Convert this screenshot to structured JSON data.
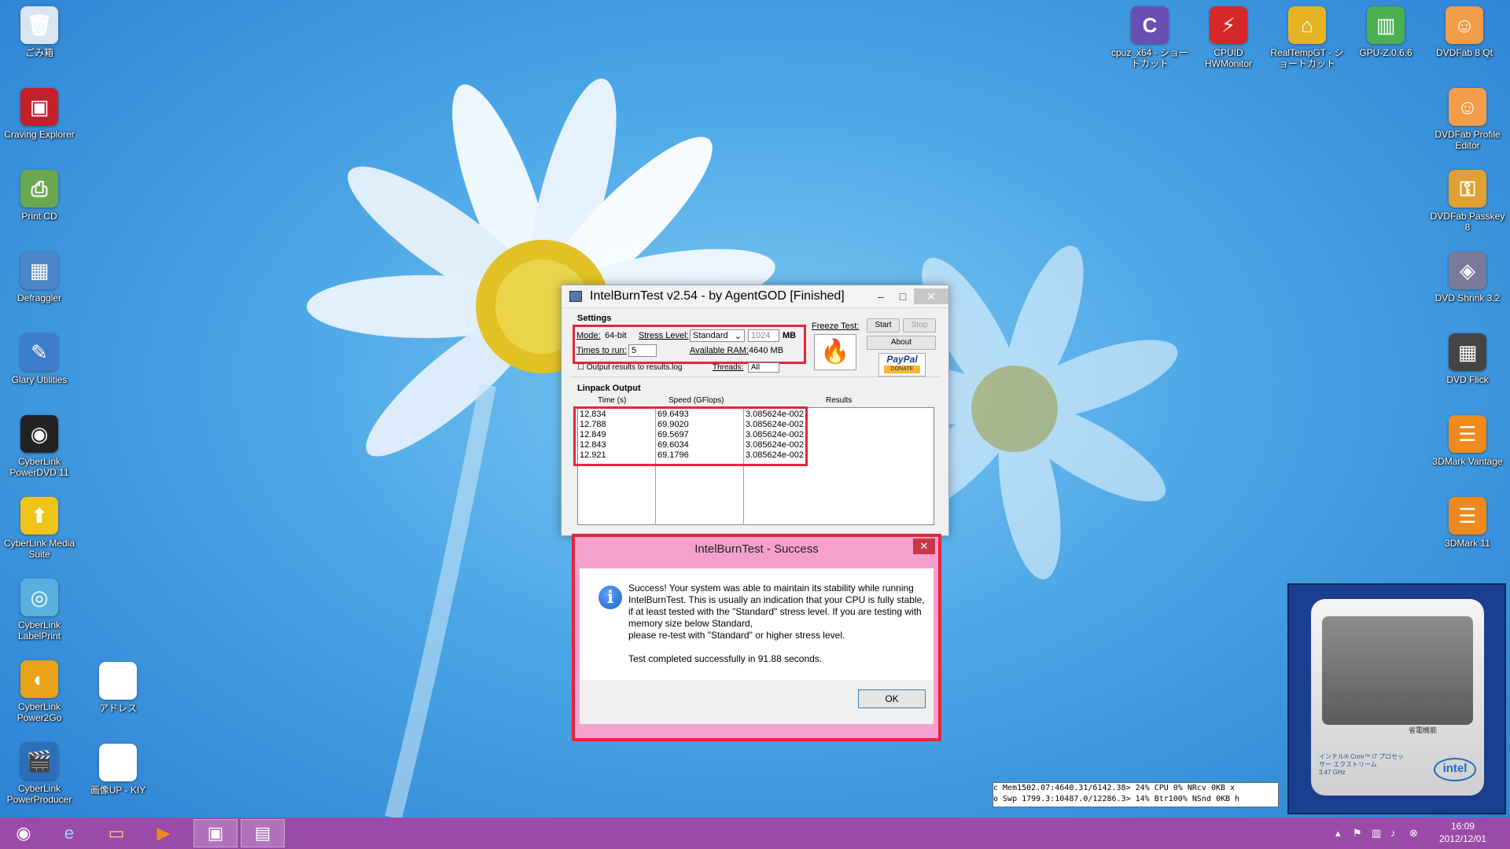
{
  "desktop_left": [
    {
      "label": "ごみ箱",
      "icon": "recycle-bin-icon",
      "glyph": "🗑",
      "color": "#d9e6f2"
    },
    {
      "label": "Craving Explorer",
      "icon": "craving-explorer-icon",
      "glyph": "▣",
      "color": "#c3202b"
    },
    {
      "label": "Print CD",
      "icon": "print-cd-icon",
      "glyph": "⎙",
      "color": "#6aa84f"
    },
    {
      "label": "Defraggler",
      "icon": "defraggler-icon",
      "glyph": "▦",
      "color": "#4a86c8"
    },
    {
      "label": "Glary Utilities",
      "icon": "glary-utilities-icon",
      "glyph": "✎",
      "color": "#3d7cc9"
    },
    {
      "label": "CyberLink PowerDVD 11",
      "icon": "powerdvd-icon",
      "glyph": "◉",
      "color": "#222222"
    },
    {
      "label": "CyberLink Media Suite",
      "icon": "media-suite-icon",
      "glyph": "⬆",
      "color": "#f0c419"
    },
    {
      "label": "CyberLink LabelPrint",
      "icon": "labelprint-icon",
      "glyph": "◎",
      "color": "#58b0e0"
    },
    {
      "label": "CyberLink Power2Go",
      "icon": "power2go-icon",
      "glyph": "◐",
      "color": "#e8a317"
    },
    {
      "label": "CyberLink PowerProducer",
      "icon": "powerproducer-icon",
      "glyph": "🎬",
      "color": "#2a6fb8"
    }
  ],
  "desktop_mid": [
    {
      "label": "アドレス",
      "icon": "document-icon",
      "glyph": "▤",
      "color": "#ffffff"
    },
    {
      "label": "画像UP - KIY",
      "icon": "document-icon",
      "glyph": "▤",
      "color": "#ffffff"
    }
  ],
  "desktop_top": [
    {
      "label": "cpuz_x64 - ショートカット",
      "icon": "cpuz-icon",
      "glyph": "C",
      "color": "#6a4fb3"
    },
    {
      "label": "CPUID HWMonitor",
      "icon": "hwmonitor-icon",
      "glyph": "⚡",
      "color": "#d62828"
    },
    {
      "label": "RealTempGT - ショートカット",
      "icon": "realtemp-icon",
      "glyph": "⌂",
      "color": "#e6b422"
    },
    {
      "label": "GPU-Z.0.6.6",
      "icon": "gpuz-icon",
      "glyph": "▥",
      "color": "#4caf50"
    },
    {
      "label": "DVDFab 8 Qt",
      "icon": "dvdfab-icon",
      "glyph": "☺",
      "color": "#f39c4a"
    }
  ],
  "desktop_right": [
    {
      "label": "DVDFab Profile Editor",
      "icon": "dvdfab-profile-icon",
      "glyph": "☺",
      "color": "#f39c4a"
    },
    {
      "label": "DVDFab Passkey 8",
      "icon": "passkey-icon",
      "glyph": "⚿",
      "color": "#e0a030"
    },
    {
      "label": "DVD Shrink 3.2",
      "icon": "dvd-shrink-icon",
      "glyph": "◈",
      "color": "#7a7a9a"
    },
    {
      "label": "DVD Flick",
      "icon": "dvd-flick-icon",
      "glyph": "▦",
      "color": "#444444"
    },
    {
      "label": "3DMark Vantage",
      "icon": "3dmark-vantage-icon",
      "glyph": "☰",
      "color": "#f08a1c"
    },
    {
      "label": "3DMark 11",
      "icon": "3dmark11-icon",
      "glyph": "☰",
      "color": "#f08a1c"
    }
  ],
  "ibt": {
    "title": "IntelBurnTest v2.54 - by AgentGOD [Finished]",
    "settings_label": "Settings",
    "mode_label": "Mode:",
    "mode_value": "64-bit",
    "stress_label": "Stress Level:",
    "stress_value": "Standard",
    "mem_value": "1024",
    "mem_unit": "MB",
    "times_label": "Times to run:",
    "times_value": "5",
    "avail_label": "Available RAM:",
    "avail_value": "4640 MB",
    "output_checkbox": "Output results to results.log",
    "threads_label": "Threads:",
    "threads_value": "All",
    "freeze_label": "Freeze Test:",
    "start_label": "Start",
    "stop_label": "Stop",
    "about_label": "About",
    "paypal_label": "PayPal",
    "donate_label": "DONATE",
    "linpack_label": "Linpack Output",
    "columns": [
      "Time (s)",
      "Speed (GFlops)",
      "Results"
    ],
    "rows": [
      [
        "12.834",
        "69.6493",
        "3.085624e-002"
      ],
      [
        "12.788",
        "69.9020",
        "3.085624e-002"
      ],
      [
        "12.849",
        "69.5697",
        "3.085624e-002"
      ],
      [
        "12.843",
        "69.6034",
        "3.085624e-002"
      ],
      [
        "12.921",
        "69.1796",
        "3.085624e-002"
      ]
    ]
  },
  "dialog": {
    "title": "IntelBurnTest - Success",
    "message": "Success! Your system was able to maintain its stability while running IntelBurnTest. This is usually an indication that your CPU is fully stable, if at least tested with the \"Standard\" stress level. If you are testing with memory size below Standard,\nplease re-test with \"Standard\" or higher stress level.\n\nTest completed successfully in 91.88 seconds.",
    "ok_label": "OK"
  },
  "monitor": {
    "line1": "c Mem1502.07:4640.31/6142.38> 24% CPU  0% NRcv  0KB x",
    "line2": "o Swp 1799.3:10487.0/12286.3> 14% Btr100% NSnd  0KB h"
  },
  "gadget": {
    "line1": "インテル® Core™ i7 プロセッサー エクストリーム",
    "line2": "3.47 GHz",
    "eco": "省電機能",
    "brand": "intel"
  },
  "taskbar": {
    "time": "16:09",
    "date": "2012/12/01"
  }
}
